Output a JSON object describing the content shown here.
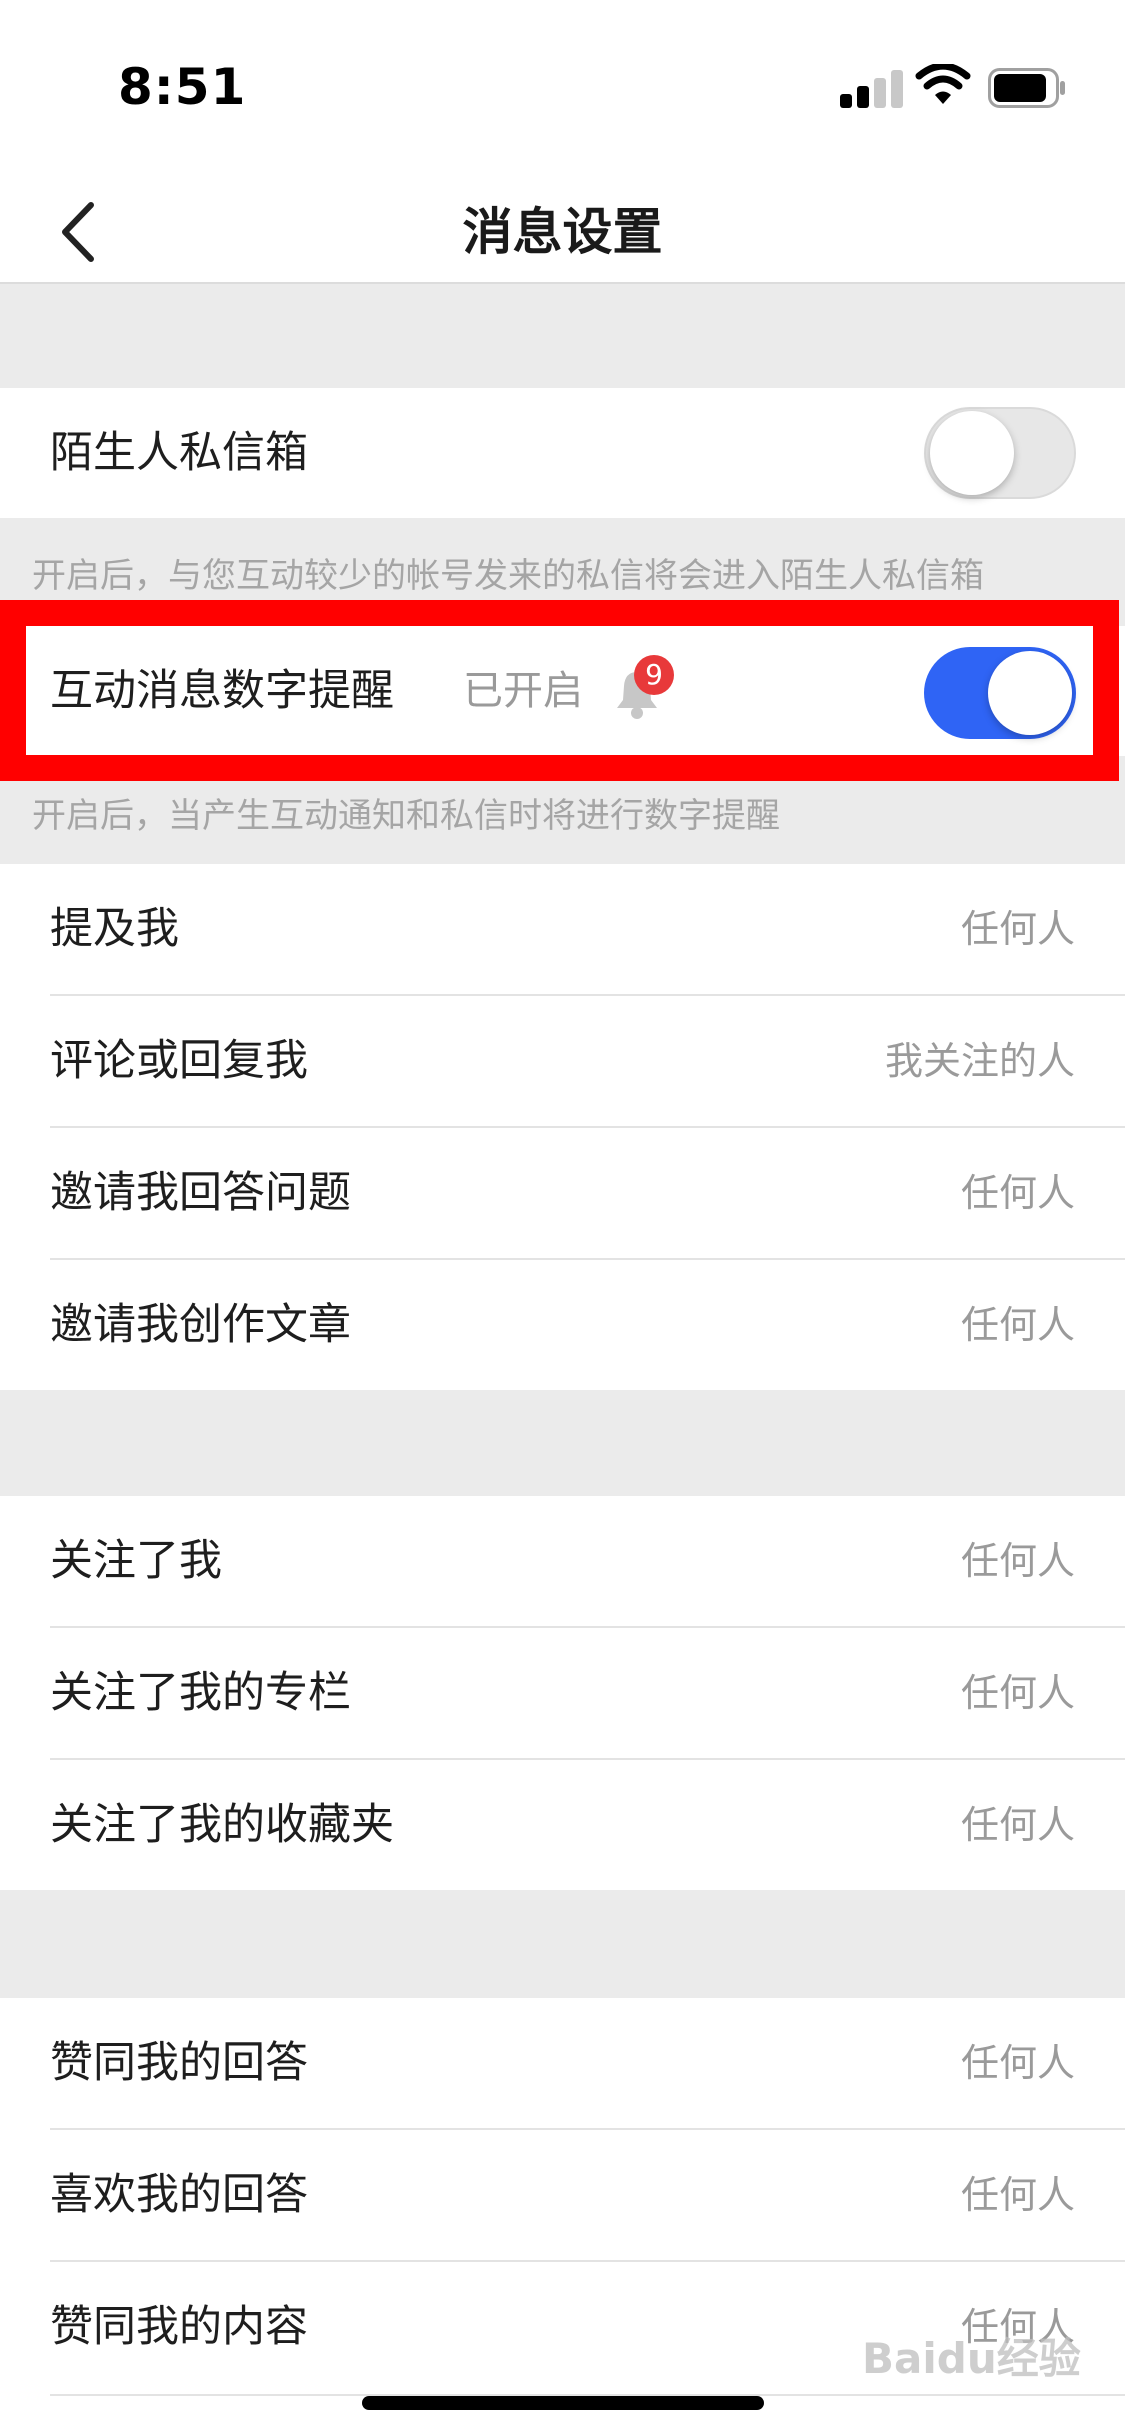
{
  "status_bar": {
    "time": "8:51"
  },
  "nav": {
    "title": "消息设置"
  },
  "stranger_inbox": {
    "label": "陌生人私信箱",
    "enabled": false
  },
  "stranger_note": "开启后，与您互动较少的帐号发来的私信将会进入陌生人私信箱",
  "interaction_badge": {
    "label": "互动消息数字提醒",
    "status": "已开启",
    "badge_count": "9",
    "enabled": true
  },
  "interaction_note": "开启后，当产生互动通知和私信时将进行数字提醒",
  "group1": [
    {
      "label": "提及我",
      "value": "任何人"
    },
    {
      "label": "评论或回复我",
      "value": "我关注的人"
    },
    {
      "label": "邀请我回答问题",
      "value": "任何人"
    },
    {
      "label": "邀请我创作文章",
      "value": "任何人"
    }
  ],
  "group2": [
    {
      "label": "关注了我",
      "value": "任何人"
    },
    {
      "label": "关注了我的专栏",
      "value": "任何人"
    },
    {
      "label": "关注了我的收藏夹",
      "value": "任何人"
    }
  ],
  "group3": [
    {
      "label": "赞同我的回答",
      "value": "任何人"
    },
    {
      "label": "喜欢我的回答",
      "value": "任何人"
    },
    {
      "label": "赞同我的内容",
      "value": "任何人"
    }
  ],
  "watermark": "Baidu经验",
  "colors": {
    "accent": "#2f64f5",
    "highlight": "#ff0000",
    "badge": "#e8393a"
  },
  "icons": [
    "back-chevron-icon",
    "signal-icon",
    "wifi-icon",
    "battery-icon",
    "bell-icon"
  ]
}
